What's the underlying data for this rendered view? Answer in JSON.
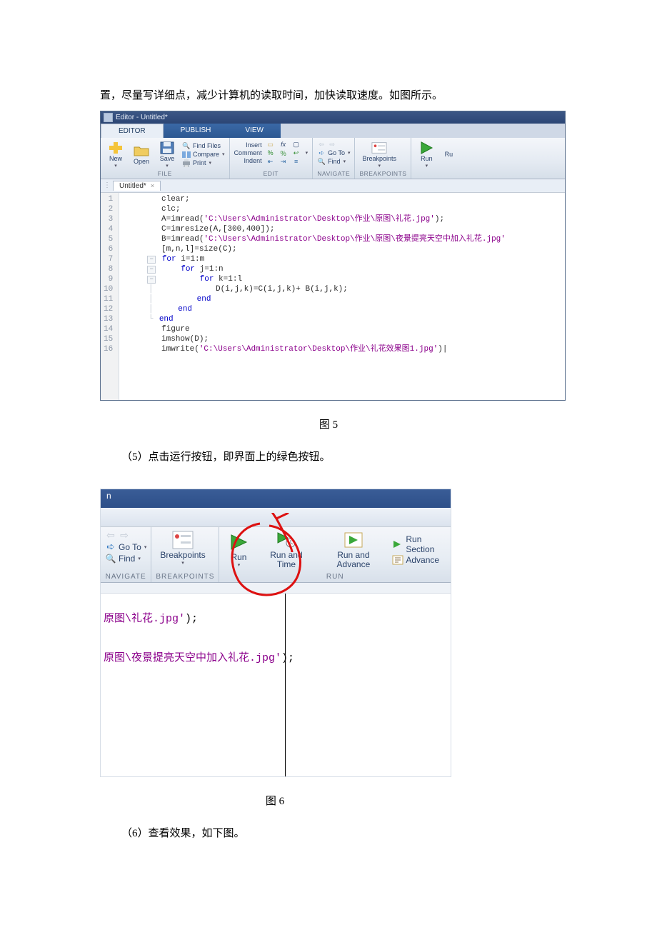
{
  "bodytext": {
    "line1": "置，尽量写详细点，减少计算机的读取时间，加快读取速度。如图所示。",
    "step5": "（5）点击运行按钮，即界面上的绿色按钮。",
    "step6": "（6）查看效果，如下图。"
  },
  "captions": {
    "fig5": "图 5",
    "fig6": "图 6"
  },
  "editor": {
    "title": "Editor - Untitled*",
    "tabs": {
      "editor": "EDITOR",
      "publish": "PUBLISH",
      "view": "VIEW"
    },
    "file": {
      "label": "FILE",
      "new": "New",
      "open": "Open",
      "save": "Save",
      "find_files": "Find Files",
      "compare": "Compare",
      "print": "Print"
    },
    "edit": {
      "label": "EDIT",
      "insert": "Insert",
      "comment2": "Comment",
      "indent": "Indent"
    },
    "navigate": {
      "label": "NAVIGATE",
      "goto": "Go To",
      "find": "Find"
    },
    "breakpoints": {
      "label": "BREAKPOINTS",
      "btn": "Breakpoints"
    },
    "run": {
      "btn": "Run",
      "btn2": "Ru"
    },
    "filetab": {
      "name": "Untitled*",
      "close": "×"
    },
    "code": {
      "l1": "clear;",
      "l2": "clc;",
      "l3a": "A=imread(",
      "l3b": "'C:\\Users\\Administrator\\Desktop\\作业\\原图\\礼花.jpg'",
      "l3c": ");",
      "l4": "C=imresize(A,[300,400]);",
      "l5a": "B=imread(",
      "l5b": "'C:\\Users\\Administrator\\Desktop\\作业\\原图\\夜景提亮天空中加入礼花.jpg'",
      "l6": "[m,n,l]=size(C);",
      "l7": "for i=1:m",
      "l8": "for j=1:n",
      "l9": "for k=1:l",
      "l10": "D(i,j,k)=C(i,j,k)+ B(i,j,k);",
      "l11": "end",
      "l12": "end",
      "l13": "end",
      "l14": "figure",
      "l15": "imshow(D);",
      "l16a": "imwrite(",
      "l16b": "'C:\\Users\\Administrator\\Desktop\\作业\\礼花效果图1.jpg'",
      "l16c": ")"
    },
    "gutter": [
      "1",
      "2",
      "3",
      "4",
      "5",
      "6",
      "7",
      "8",
      "9",
      "10",
      "11",
      "12",
      "13",
      "14",
      "15",
      "16"
    ]
  },
  "fig6": {
    "header": "n",
    "navigate": {
      "label": "NAVIGATE",
      "goto": "Go To",
      "find": "Find"
    },
    "breakpoints": {
      "label": "BREAKPOINTS",
      "btn": "Breakpoints"
    },
    "run": {
      "label": "RUN",
      "run": "Run",
      "run_time": "Run and Time",
      "run_adv": "Run and Advance",
      "run_sec": "Run Section",
      "advance": "Advance"
    },
    "code": {
      "l1a": "原图\\礼花.jpg'",
      "l1b": ");",
      "l2a": "原图\\夜景提亮天空中加入礼花.jpg'",
      "l2b": ");"
    }
  }
}
